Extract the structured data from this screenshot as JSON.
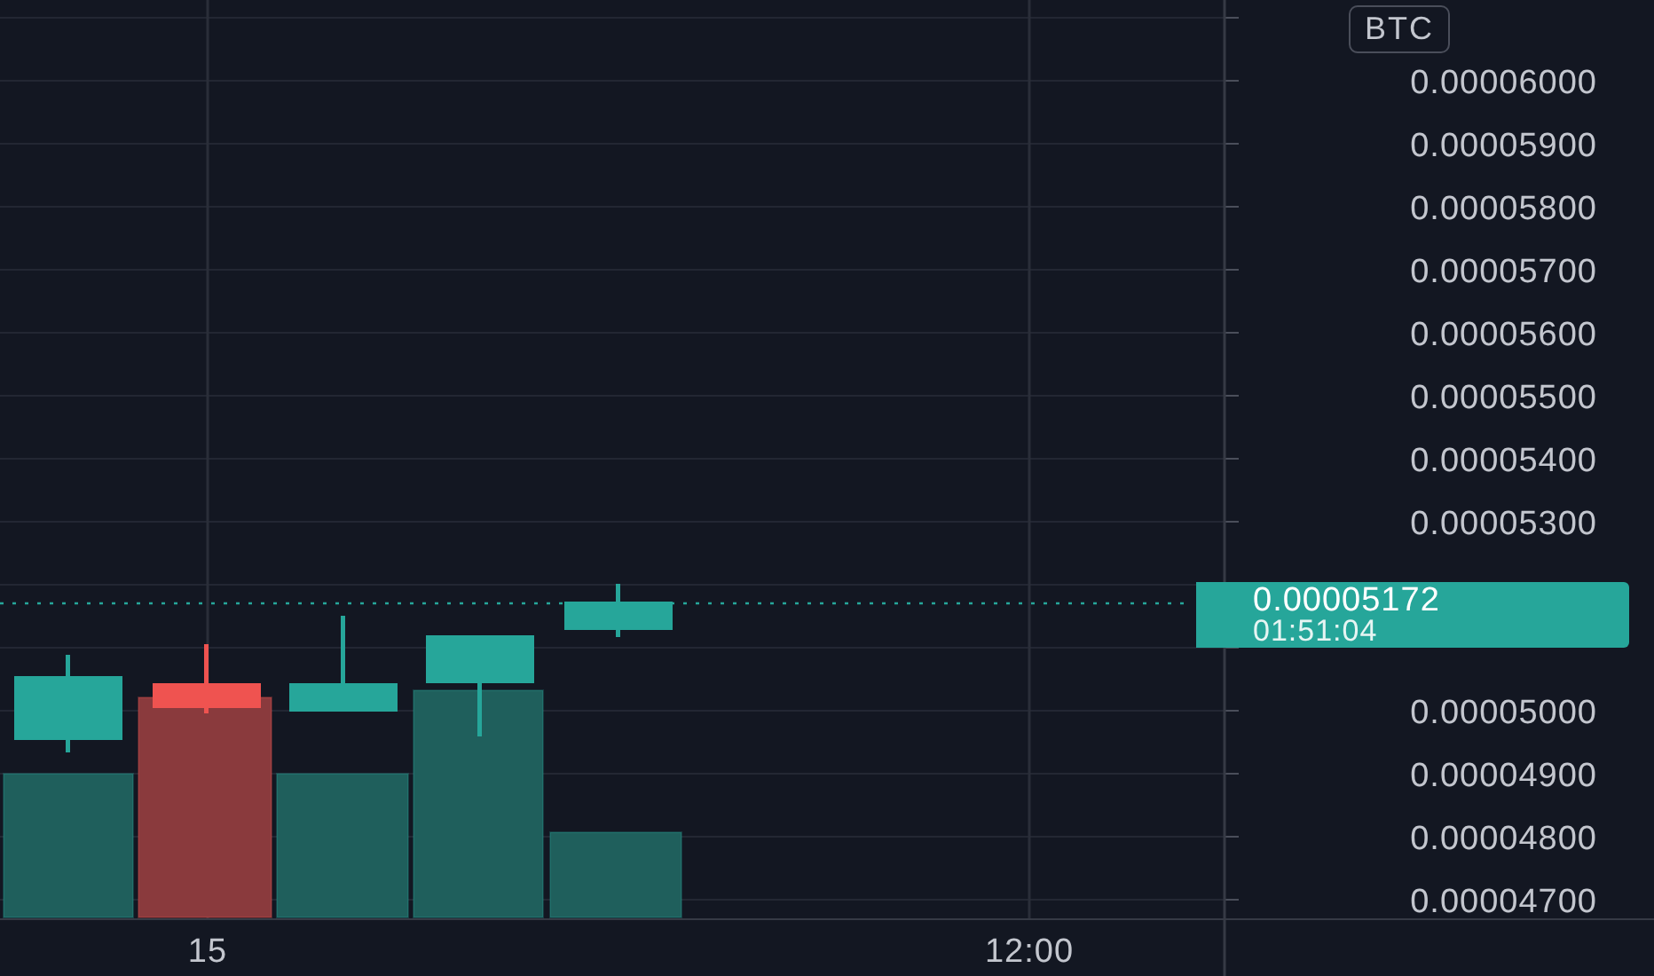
{
  "currency_badge": "BTC",
  "price_axis": {
    "upper_labels": [
      "0.00006000",
      "0.00005900",
      "0.00005800",
      "0.00005700",
      "0.00005600",
      "0.00005500",
      "0.00005400",
      "0.00005300"
    ],
    "lower_labels": [
      "0.00005000",
      "0.00004900",
      "0.00004800",
      "0.00004700"
    ]
  },
  "current_price": {
    "price": "0.00005172",
    "countdown": "01:51:04"
  },
  "time_axis": [
    "15",
    "12:00"
  ],
  "candles": [
    {
      "rising": true
    },
    {
      "rising": false
    },
    {
      "rising": true
    },
    {
      "rising": true
    },
    {
      "rising": true
    }
  ]
}
